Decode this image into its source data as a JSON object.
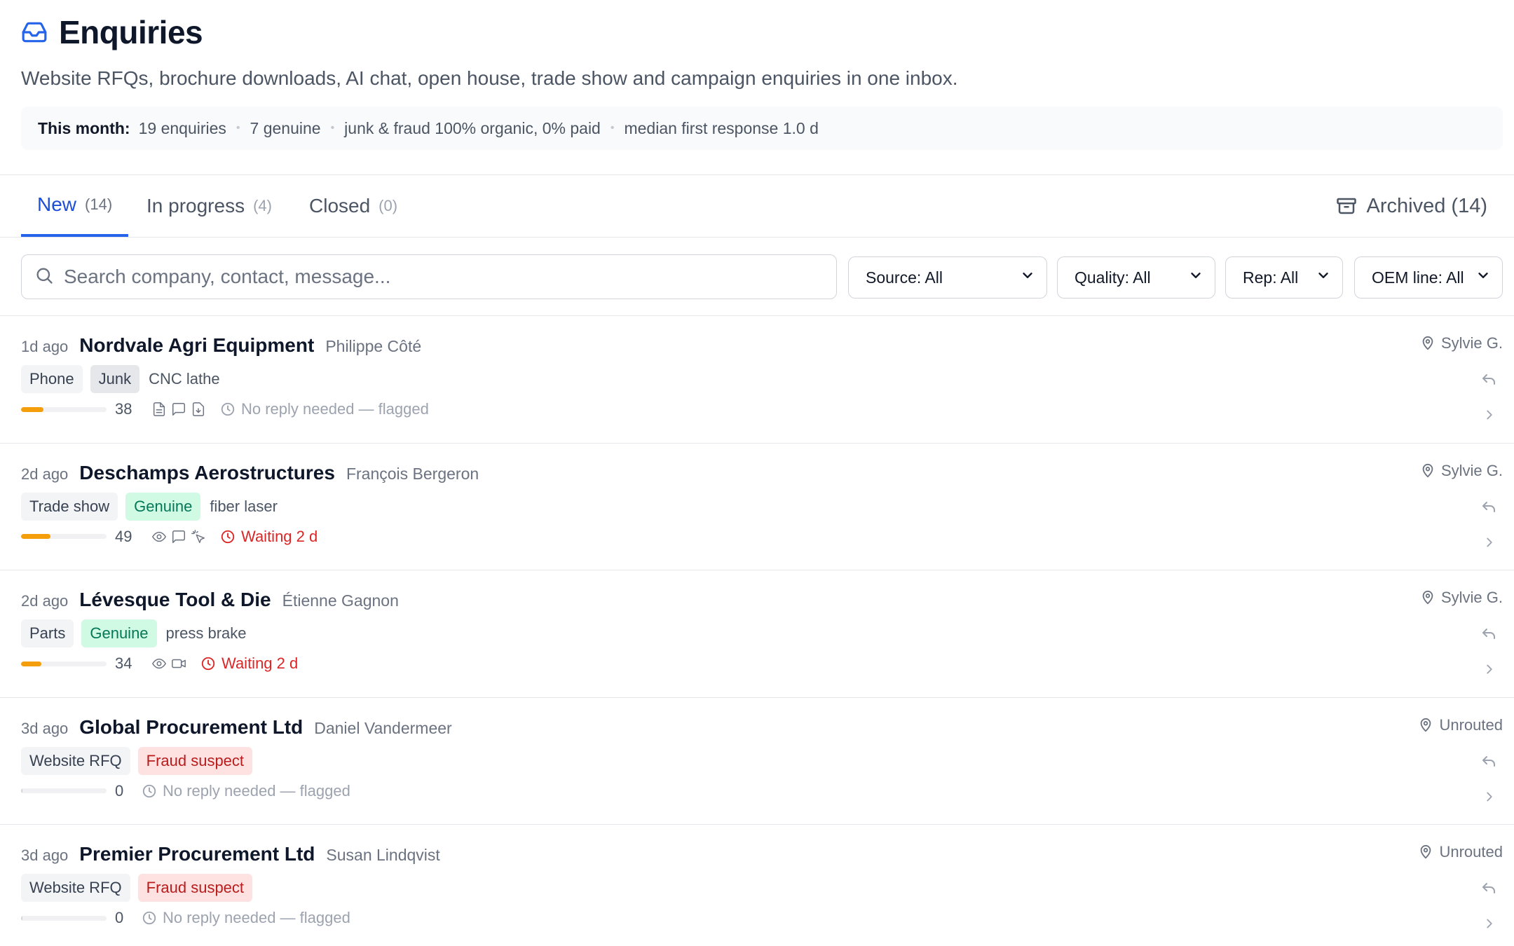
{
  "header": {
    "title": "Enquiries",
    "subtitle": "Website RFQs, brochure downloads, AI chat, open house, trade show and campaign enquiries in one inbox.",
    "stats": {
      "label": "This month:",
      "enquiries": "19 enquiries",
      "genuine": "7 genuine",
      "junk": "junk & fraud 100% organic, 0% paid",
      "response": "median first response 1.0 d"
    }
  },
  "tabs": [
    {
      "label": "New",
      "count": "(14)"
    },
    {
      "label": "In progress",
      "count": "(4)"
    },
    {
      "label": "Closed",
      "count": "(0)"
    }
  ],
  "archived": "Archived (14)",
  "search": {
    "placeholder": "Search company, contact, message..."
  },
  "filters": {
    "source": "Source: All",
    "quality": "Quality: All",
    "rep": "Rep: All",
    "oem": "OEM line: All"
  },
  "colors": {
    "accent": "#2563eb",
    "bar": "#f59e0b",
    "waiting": "#dc2626",
    "genuine": "#047857",
    "fraud": "#b91c1c"
  },
  "enquiries": [
    {
      "ago": "1d ago",
      "company": "Nordvale Agri Equipment",
      "contact": "Philippe Côté",
      "source": "Phone",
      "quality": "Junk",
      "product": "CNC lathe",
      "score": "38",
      "score_pct": 38,
      "signals": [
        "document-icon",
        "chat-icon",
        "download-icon"
      ],
      "status": "No reply needed — flagged",
      "owner": "Sylvie G."
    },
    {
      "ago": "2d ago",
      "company": "Deschamps Aerostructures",
      "contact": "François Bergeron",
      "source": "Trade show",
      "quality": "Genuine",
      "product": "fiber laser",
      "score": "49",
      "score_pct": 49,
      "signals": [
        "eye-icon",
        "chat-icon",
        "click-icon"
      ],
      "status": "Waiting 2 d",
      "owner": "Sylvie G."
    },
    {
      "ago": "2d ago",
      "company": "Lévesque Tool & Die",
      "contact": "Étienne Gagnon",
      "source": "Parts",
      "quality": "Genuine",
      "product": "press brake",
      "score": "34",
      "score_pct": 34,
      "signals": [
        "eye-icon",
        "video-icon"
      ],
      "status": "Waiting 2 d",
      "owner": "Sylvie G."
    },
    {
      "ago": "3d ago",
      "company": "Global Procurement Ltd",
      "contact": "Daniel Vandermeer",
      "source": "Website RFQ",
      "quality": "Fraud suspect",
      "product": "",
      "score": "0",
      "score_pct": 0,
      "signals": [],
      "status": "No reply needed — flagged",
      "owner": "Unrouted"
    },
    {
      "ago": "3d ago",
      "company": "Premier Procurement Ltd",
      "contact": "Susan Lindqvist",
      "source": "Website RFQ",
      "quality": "Fraud suspect",
      "product": "",
      "score": "0",
      "score_pct": 0,
      "signals": [],
      "status": "No reply needed — flagged",
      "owner": "Unrouted"
    }
  ]
}
